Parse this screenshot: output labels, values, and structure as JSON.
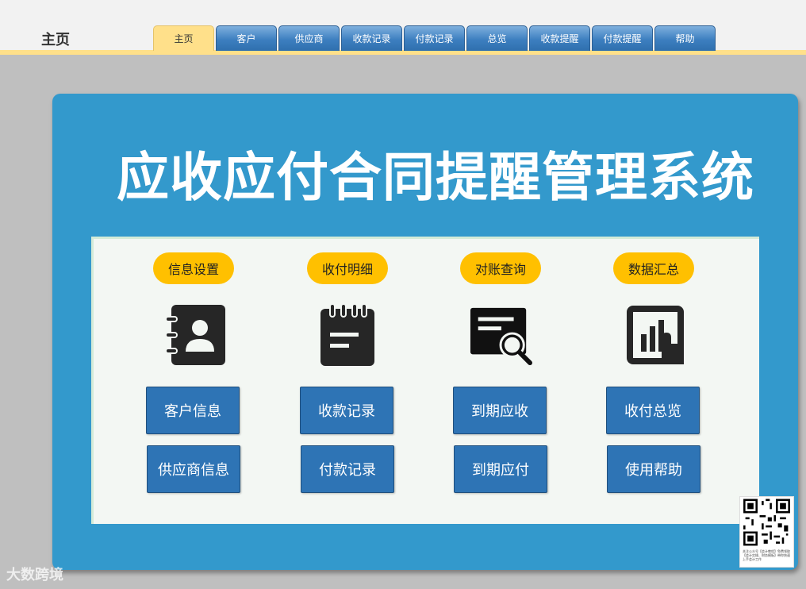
{
  "header": {
    "page_label": "主页",
    "tabs": [
      "主页",
      "客户",
      "供应商",
      "收款记录",
      "付款记录",
      "总览",
      "收款提醒",
      "付款提醒",
      "帮助"
    ]
  },
  "main": {
    "title": "应收应付合同提醒管理系统",
    "sections": [
      {
        "label": "信息设置",
        "icon": "contacts-book-icon",
        "buttons": [
          "客户信息",
          "供应商信息"
        ]
      },
      {
        "label": "收付明细",
        "icon": "notepad-icon",
        "buttons": [
          "收款记录",
          "付款记录"
        ]
      },
      {
        "label": "对账查询",
        "icon": "document-search-icon",
        "buttons": [
          "到期应收",
          "到期应付"
        ]
      },
      {
        "label": "数据汇总",
        "icon": "tablet-chart-icon",
        "buttons": [
          "收付总览",
          "使用帮助"
        ]
      }
    ]
  },
  "footer": {
    "watermark": "大数跨境",
    "qr_caption": "关注公众号【会计教程】免费领取【会计实操、财务模板】带你快速上手会计工作"
  },
  "colors": {
    "panel": "#3399cc",
    "pill": "#ffc000",
    "button": "#2e74b5",
    "active_tab": "#ffe08a"
  }
}
